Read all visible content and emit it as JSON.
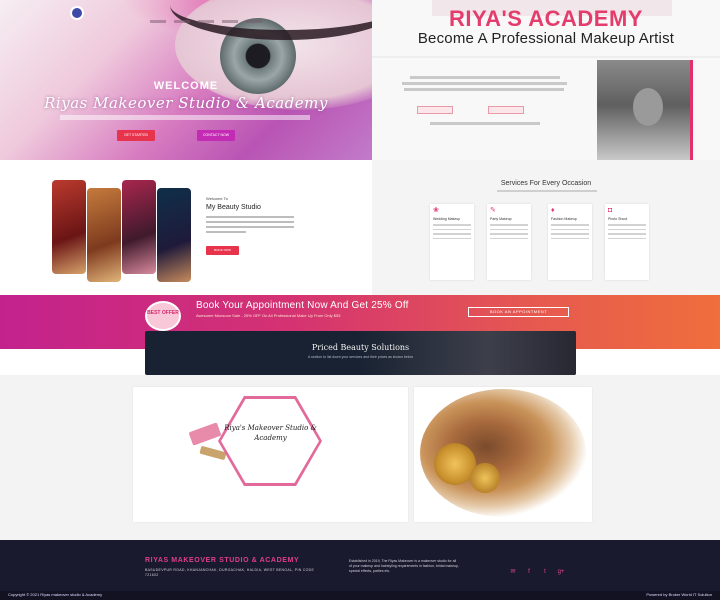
{
  "hero": {
    "welcome": "WELCOME",
    "title": "Riyas Makeover Studio & Academy",
    "buttons": [
      "GET STARTED",
      "CONTACT NOW"
    ]
  },
  "academy": {
    "brand": "RIYA'S ACADEMY",
    "subtitle": "Become A Professional Makeup Artist"
  },
  "studio": {
    "welcome_to": "Welcome To",
    "title": "My Beauty Studio",
    "button": "BOOK NOW"
  },
  "services": {
    "title": "Services For Every Occasion",
    "cards": [
      {
        "title": "Wedding Makeup",
        "icon": "bride-icon"
      },
      {
        "title": "Party Makeup",
        "icon": "brush-icon"
      },
      {
        "title": "Fashion Makeup",
        "icon": "lipstick-icon"
      },
      {
        "title": "Photo Shoot",
        "icon": "camera-icon"
      }
    ]
  },
  "promo": {
    "badge": "BEST OFFER",
    "title": "Book Your Appointment Now And Get 25% Off",
    "subtitle": "Awesome Monsoon Sale - 25% OFF On All Professional Make Up From Only $55",
    "button": "BOOK AN APPOINTMENT"
  },
  "priced": {
    "title": "Priced Beauty Solutions",
    "subtitle": "A section to list down your services and their prices as shown below"
  },
  "gallery": {
    "logo_text": "Riya's Makeover Studio & Academy"
  },
  "footer": {
    "brand": "RIYAS MAKEOVER STUDIO & ACADEMY",
    "address": "BASUDEVPUR ROAD, KHANJANCHAK, DURGACHAK, HALDIA, WEST BENGAL, PIN CODE 721602",
    "description": "Established in 2019, The Riyas Makeover is a makeover studio for all of your makeup and hairstyling requirements in fashion, bridal makeup, special effects, parties etc.",
    "socials": [
      "email-icon",
      "facebook-icon",
      "twitter-icon",
      "googleplus-icon"
    ],
    "copyright": "Copyright © 2021 Riyas makeover studio & Academy",
    "powered": "Powered by Broker World IT Solution"
  },
  "colors": {
    "accent_pink": "#e43d6d",
    "button_red": "#e8334d",
    "footer_bg": "#1a1a2e"
  }
}
